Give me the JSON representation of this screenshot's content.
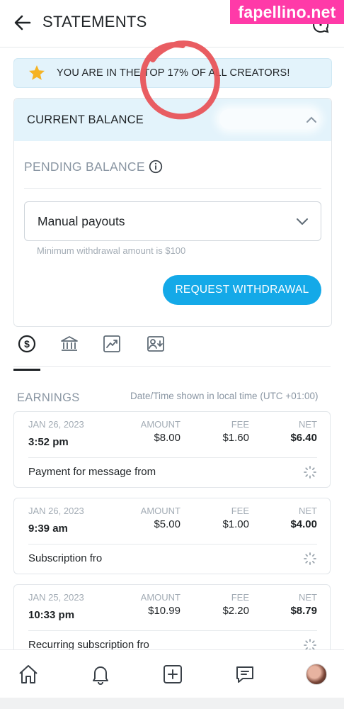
{
  "header": {
    "title": "STATEMENTS",
    "back_icon": "back-arrow-icon",
    "right_icon": "help-chat-icon"
  },
  "watermark": "fapellino.net",
  "rank_banner": {
    "text": "YOU ARE IN THE TOP 17% OF ALL CREATORS!",
    "icon": "star-icon"
  },
  "balance": {
    "current_label": "CURRENT BALANCE",
    "pending_label": "PENDING BALANCE",
    "payout_method": "Manual payouts",
    "minimum_note": "Minimum withdrawal amount is $100",
    "withdraw_button": "REQUEST WITHDRAWAL"
  },
  "tabs": [
    {
      "icon": "dollar-icon",
      "active": true
    },
    {
      "icon": "bank-icon",
      "active": false
    },
    {
      "icon": "chart-icon",
      "active": false
    },
    {
      "icon": "payout-request-icon",
      "active": false
    }
  ],
  "earnings": {
    "title": "EARNINGS",
    "note": "Date/Time shown in local time (UTC +01:00)",
    "headers": {
      "amount": "AMOUNT",
      "fee": "FEE",
      "net": "NET"
    },
    "transactions": [
      {
        "date": "JAN 26, 2023",
        "time": "3:52 pm",
        "amount": "$8.00",
        "fee": "$1.60",
        "net": "$6.40",
        "description": "Payment for message from"
      },
      {
        "date": "JAN 26, 2023",
        "time": "9:39 am",
        "amount": "$5.00",
        "fee": "$1.00",
        "net": "$4.00",
        "description": "Subscription fro"
      },
      {
        "date": "JAN 25, 2023",
        "time": "10:33 pm",
        "amount": "$10.99",
        "fee": "$2.20",
        "net": "$8.79",
        "description": "Recurring subscription fro"
      }
    ]
  },
  "bottom_nav": [
    "home-icon",
    "bell-icon",
    "add-post-icon",
    "messages-icon",
    "profile-avatar"
  ],
  "colors": {
    "accent": "#14a9e8",
    "banner_bg": "#e3f3fb",
    "marker": "#e8545a",
    "watermark_bg": "#ff3aa8"
  }
}
